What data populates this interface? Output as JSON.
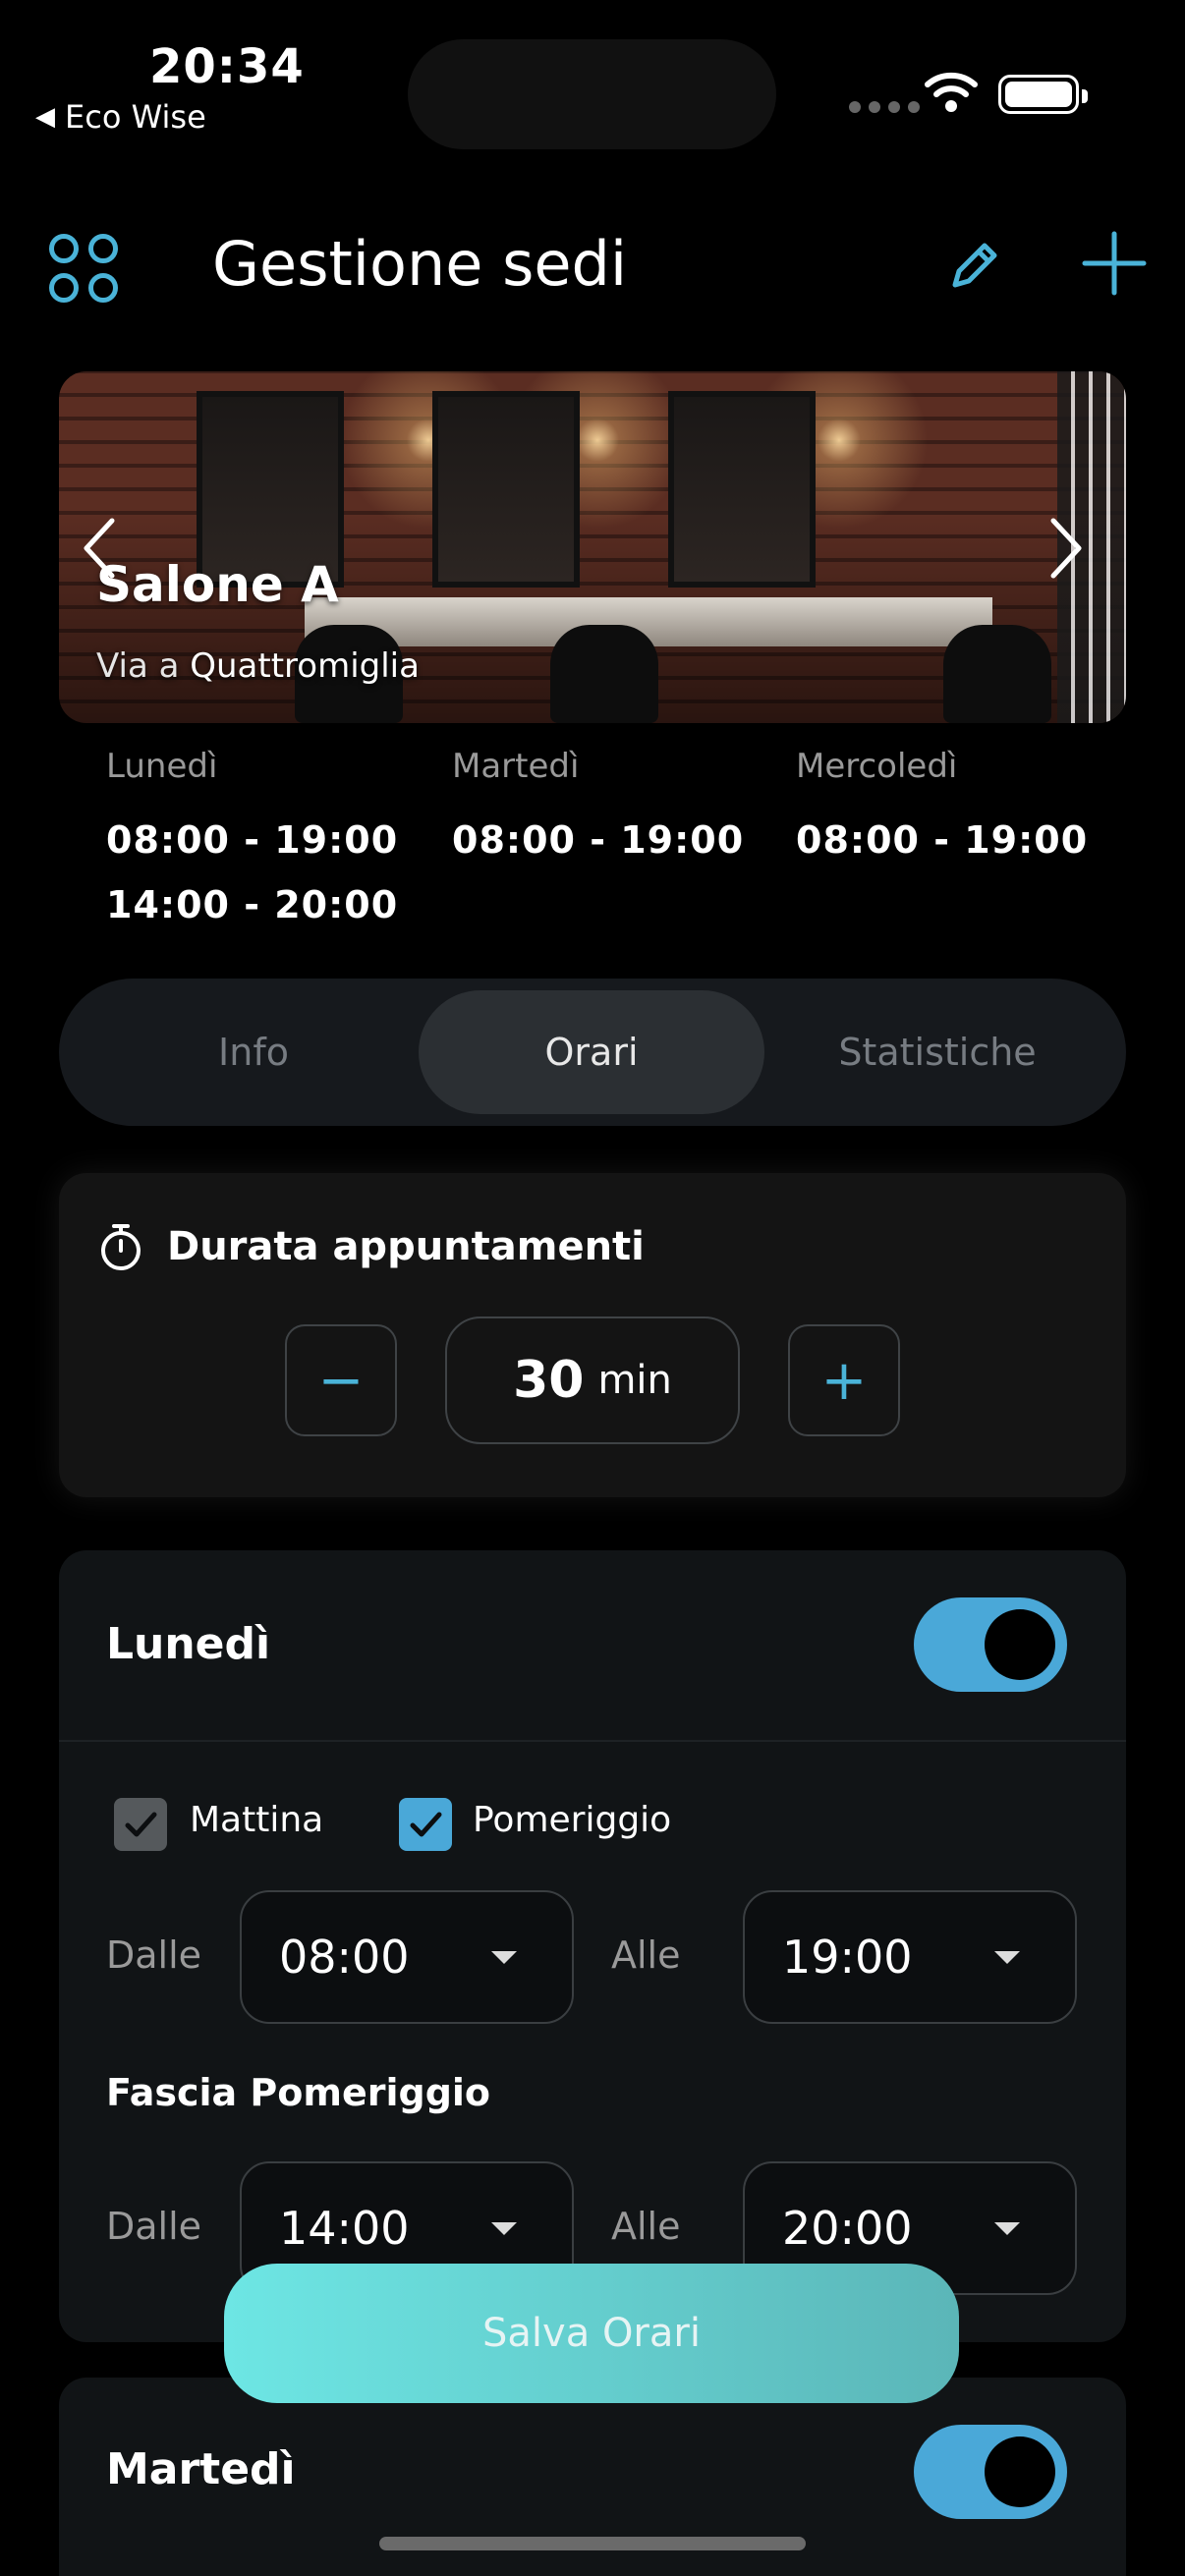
{
  "status_bar": {
    "time": "20:34",
    "back_app": "Eco Wise"
  },
  "header": {
    "title": "Gestione sedi"
  },
  "carousel": {
    "salon_name": "Salone A",
    "address_prefix": "Via a",
    "address_name": "Quattromiglia"
  },
  "week_preview": [
    {
      "day": "Lunedì",
      "times": [
        "08:00 - 19:00",
        "14:00 - 20:00"
      ]
    },
    {
      "day": "Martedì",
      "times": [
        "08:00 - 19:00"
      ]
    },
    {
      "day": "Mercoledì",
      "times": [
        "08:00 - 19:00"
      ]
    }
  ],
  "tabs": [
    {
      "label": "Info",
      "active": false
    },
    {
      "label": "Orari",
      "active": true
    },
    {
      "label": "Statistiche",
      "active": false
    }
  ],
  "duration": {
    "title": "Durata appuntamenti",
    "value": "30",
    "unit": "min",
    "minus": "−",
    "plus": "+"
  },
  "monday": {
    "title": "Lunedì",
    "enabled": true,
    "morning_label": "Mattina",
    "morning_checked": true,
    "afternoon_label": "Pomeriggio",
    "afternoon_checked": true,
    "from_label": "Dalle",
    "to_label": "Alle",
    "morning_from": "08:00",
    "morning_to": "19:00",
    "afternoon_section": "Fascia Pomeriggio",
    "afternoon_from": "14:00",
    "afternoon_to": "20:00"
  },
  "save_button": "Salva Orari",
  "tuesday": {
    "title": "Martedì",
    "enabled": true
  },
  "colors": {
    "accent": "#4aa8d8",
    "save_start": "#6de6e4",
    "save_end": "#5bb6b8",
    "background": "#000000"
  }
}
